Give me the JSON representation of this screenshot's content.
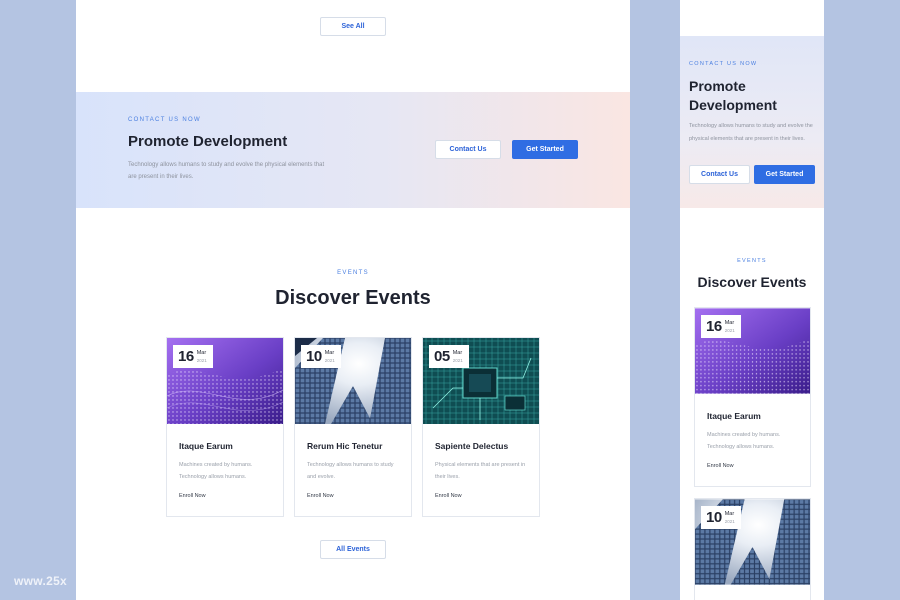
{
  "desktop": {
    "see_all": "See All",
    "cta": {
      "eyebrow": "CONTACT US NOW",
      "title": "Promote Development",
      "text": "Technology allows humans to study and evolve the physical elements that are present in their lives.",
      "contact_label": "Contact Us",
      "start_label": "Get Started"
    },
    "events": {
      "eyebrow": "EVENTS",
      "title": "Discover Events",
      "all_label": "All Events",
      "cards": [
        {
          "day": "16",
          "month": "Mar",
          "year": "2021",
          "title": "Itaque Earum",
          "desc": "Machines created by humans. Technology allows humans.",
          "link": "Enroll Now",
          "image": "purple-wave-image"
        },
        {
          "day": "10",
          "month": "Mar",
          "year": "2021",
          "title": "Rerum Hic Tenetur",
          "desc": "Technology allows humans to study and evolve.",
          "link": "Enroll Now",
          "image": "skyscraper-image"
        },
        {
          "day": "05",
          "month": "Mar",
          "year": "2021",
          "title": "Sapiente Delectus",
          "desc": "Physical elements that are present in their lives.",
          "link": "Enroll Now",
          "image": "circuit-board-image"
        }
      ]
    }
  },
  "mobile": {
    "cta": {
      "eyebrow": "CONTACT US NOW",
      "title": "Promote Development",
      "text": "Technology allows humans to study and evolve the physical elements that are present in their lives.",
      "contact_label": "Contact Us",
      "start_label": "Get Started"
    },
    "events": {
      "eyebrow": "EVENTS",
      "title": "Discover Events",
      "cards": [
        {
          "day": "16",
          "month": "Mar",
          "year": "2021",
          "title": "Itaque Earum",
          "desc": "Machines created by humans. Technology allows humans.",
          "link": "Enroll Now"
        },
        {
          "day": "10",
          "month": "Mar",
          "year": "2021"
        }
      ]
    }
  },
  "watermark": "www.25x",
  "colors": {
    "background": "#b4c4e2",
    "accent": "#2f6de3",
    "eyebrow": "#4a7fe0",
    "heading": "#1f2330",
    "muted": "#9aa0aa"
  }
}
